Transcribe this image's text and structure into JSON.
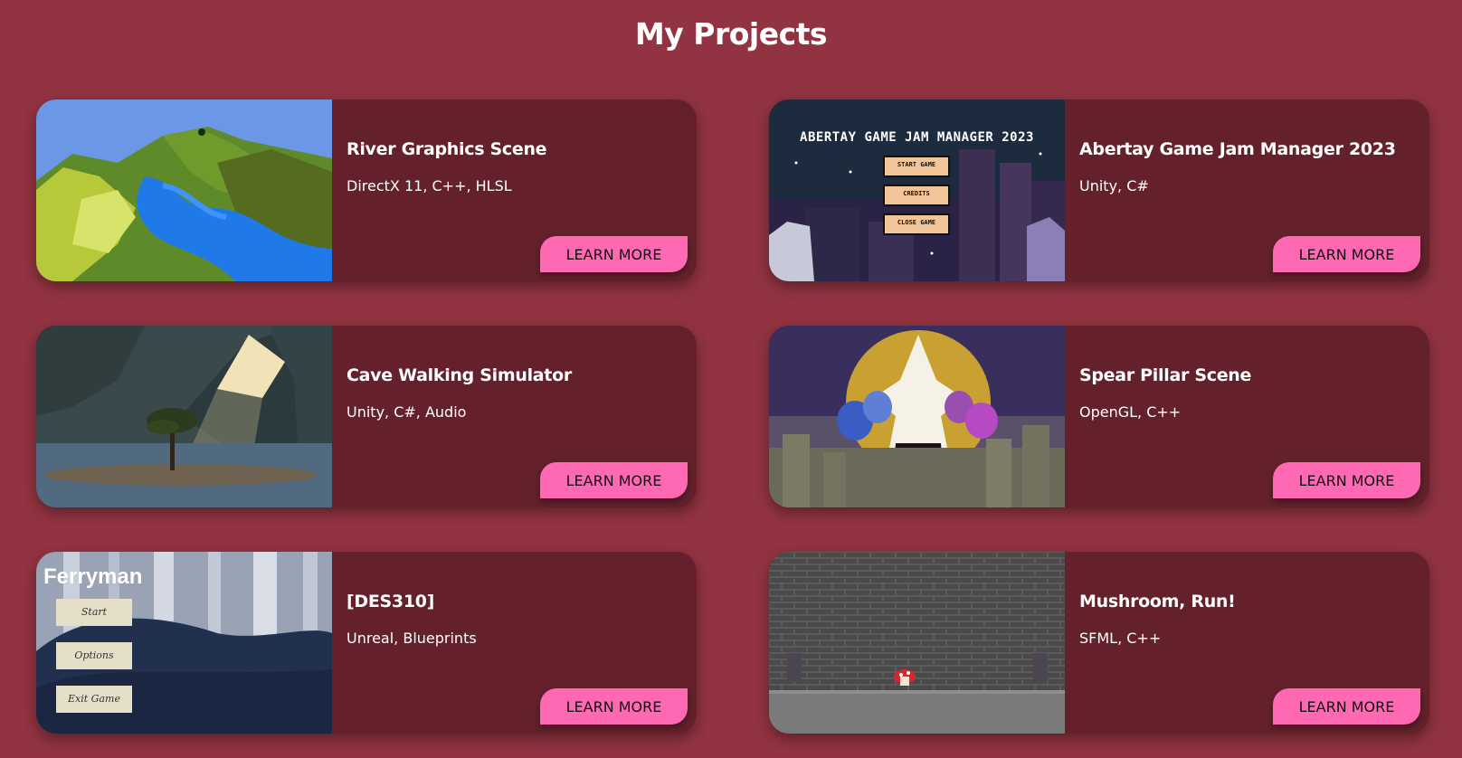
{
  "page": {
    "title": "My Projects",
    "background": "#913340"
  },
  "theme": {
    "card_bg": "#64212b",
    "button_bg": "#ff69b4",
    "button_text": "#111111"
  },
  "projects": [
    {
      "title": "River Graphics Scene",
      "tech": "DirectX 11, C++, HLSL",
      "button_label": "LEARN MORE",
      "thumbnail": "river-terrain-image"
    },
    {
      "title": "Abertay Game Jam Manager 2023",
      "tech": "Unity, C#",
      "button_label": "LEARN MORE",
      "thumbnail": "game-jam-menu-image",
      "thumbnail_text": {
        "heading": "ABERTAY GAME JAM MANAGER 2023",
        "menu": [
          "START GAME",
          "CREDITS",
          "CLOSE GAME"
        ]
      }
    },
    {
      "title": "Cave Walking Simulator",
      "tech": "Unity, C#, Audio",
      "button_label": "LEARN MORE",
      "thumbnail": "cave-tree-image"
    },
    {
      "title": "Spear Pillar Scene",
      "tech": "OpenGL, C++",
      "button_label": "LEARN MORE",
      "thumbnail": "spear-pillar-image"
    },
    {
      "title": "[DES310]",
      "tech": "Unreal, Blueprints",
      "button_label": "LEARN MORE",
      "thumbnail": "ferryman-menu-image",
      "thumbnail_text": {
        "heading": "Ferryman",
        "menu": [
          "Start",
          "Options",
          "Exit Game"
        ]
      }
    },
    {
      "title": "Mushroom, Run!",
      "tech": "SFML, C++",
      "button_label": "LEARN MORE",
      "thumbnail": "mushroom-run-image"
    }
  ]
}
